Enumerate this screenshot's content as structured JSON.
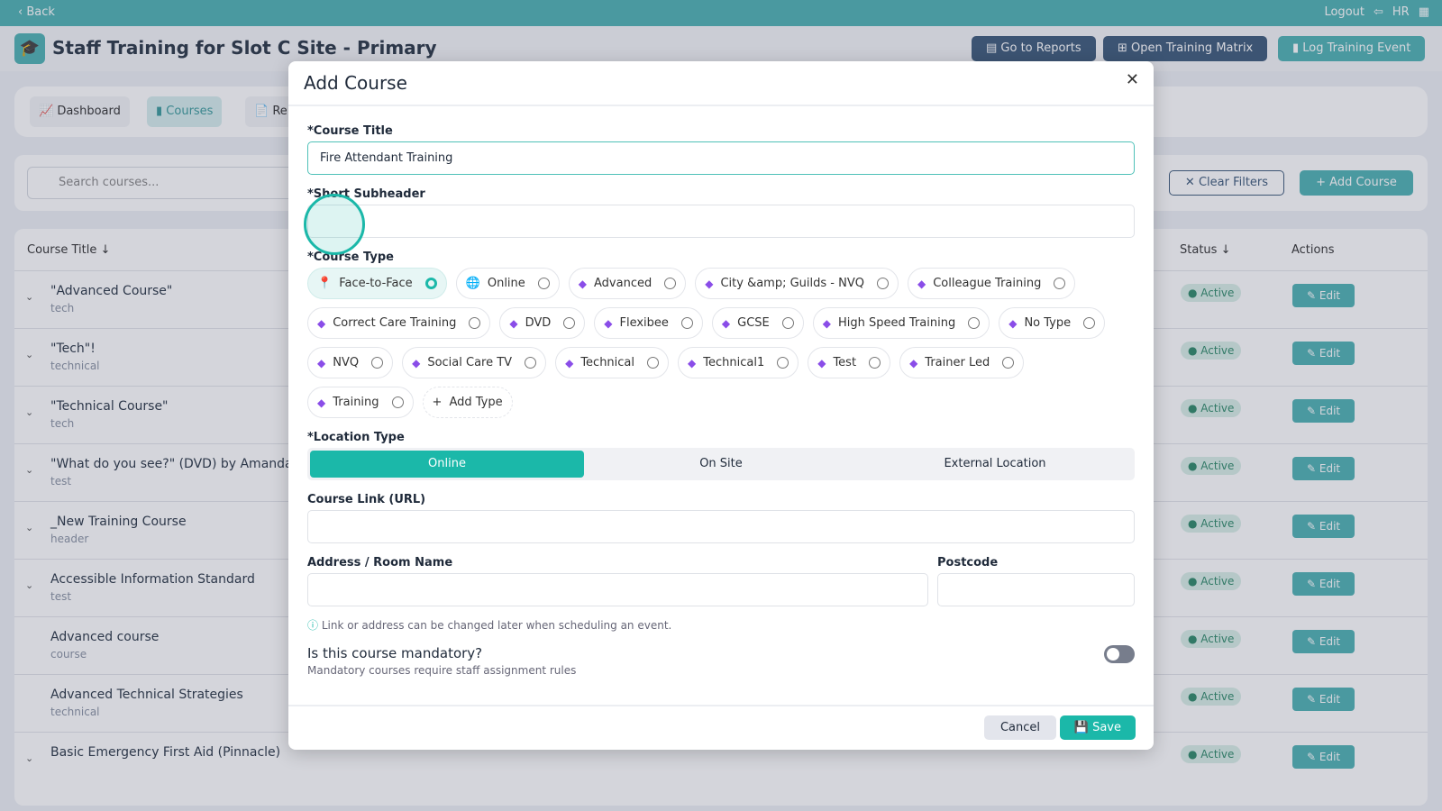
{
  "topbar": {
    "back": "‹ Back",
    "logout": "Logout",
    "user": "HR"
  },
  "header": {
    "title": "Staff Training for Slot C Site - Primary",
    "reports": "Go to Reports",
    "matrix": "Open Training Matrix",
    "log": "Log Training Event"
  },
  "nav": {
    "dashboard": "Dashboard",
    "courses": "Courses",
    "reports": "Re"
  },
  "filters": {
    "search_placeholder": "Search courses...",
    "clear": "Clear Filters",
    "add": "Add Course"
  },
  "table": {
    "col_title": "Course Title",
    "col_status": "Status",
    "col_actions": "Actions",
    "rows": [
      {
        "title": "\"Advanced Course\"",
        "sub": "tech",
        "status": "Active",
        "edit": "Edit"
      },
      {
        "title": "\"Tech\"!",
        "sub": "technical",
        "status": "Active",
        "edit": "Edit"
      },
      {
        "title": "\"Technical Course\"",
        "sub": "tech",
        "status": "Active",
        "edit": "Edit"
      },
      {
        "title": "\"What do you see?\" (DVD) by Amanda V",
        "sub": "test",
        "status": "Active",
        "edit": "Edit"
      },
      {
        "title": "_New Training Course",
        "sub": "header",
        "status": "Active",
        "edit": "Edit"
      },
      {
        "title": "Accessible Information Standard",
        "sub": "test",
        "status": "Active",
        "edit": "Edit"
      },
      {
        "title": "Advanced course",
        "sub": "course",
        "status": "Active",
        "edit": "Edit"
      },
      {
        "title": "Advanced Technical Strategies",
        "sub": "technical",
        "status": "Active",
        "edit": "Edit"
      },
      {
        "title": "Basic Emergency First Aid (Pinnacle)",
        "sub": "",
        "status": "Active",
        "edit": "Edit"
      }
    ]
  },
  "modal": {
    "title": "Add Course",
    "course_title_label": "*Course Title",
    "course_title_value": "Fire Attendant Training",
    "subheader_label": "*Short Subheader",
    "subheader_value": "",
    "course_type_label": "*Course Type",
    "types": [
      "Face-to-Face",
      "Online",
      "Advanced",
      "City &amp; Guilds - NVQ",
      "Colleague Training",
      "Correct Care Training",
      "DVD",
      "Flexibee",
      "GCSE",
      "High Speed Training",
      "No Type",
      "NVQ",
      "Social Care TV",
      "Technical",
      "Technical1",
      "Test",
      "Trainer Led",
      "Training"
    ],
    "selected_type": "Face-to-Face",
    "add_type": "Add Type",
    "location_label": "*Location Type",
    "locations": [
      "Online",
      "On Site",
      "External Location"
    ],
    "selected_location": "Online",
    "link_label": "Course Link (URL)",
    "address_label": "Address / Room Name",
    "postcode_label": "Postcode",
    "info": "Link or address can be changed later when scheduling an event.",
    "mandatory_q": "Is this course mandatory?",
    "mandatory_sub": "Mandatory courses require staff assignment rules",
    "mandatory": false,
    "cancel": "Cancel",
    "save": "Save"
  },
  "colors": {
    "accent": "#1bb8a9",
    "topbar": "#4fb3b4",
    "navy": "#3d5a7a",
    "tag": "#8a4de8"
  }
}
